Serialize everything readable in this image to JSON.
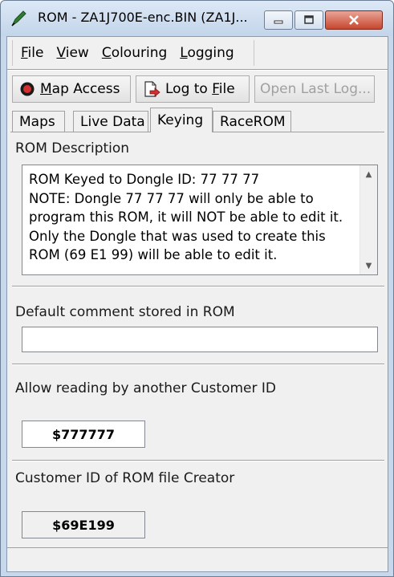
{
  "window": {
    "title": "ROM - ZA1J700E-enc.BIN (ZA1J...",
    "icons": {
      "app": "pen-icon",
      "minimize": "minimize-icon",
      "maximize": "maximize-icon",
      "close": "close-icon"
    }
  },
  "menu": {
    "file": "File",
    "view": "View",
    "colouring": "Colouring",
    "logging": "Logging"
  },
  "toolbar": {
    "map_access": "Map Access",
    "log_to_file": "Log to File",
    "open_last_log": "Open Last Log...",
    "icons": {
      "map_access": "record-icon",
      "log_to_file": "log-file-icon"
    }
  },
  "tabs": [
    "Maps",
    "Live Data",
    "Keying",
    "RaceROM"
  ],
  "active_tab": "Keying",
  "keying": {
    "rom_description_label": "ROM Description",
    "rom_description_value": "ROM Keyed to Dongle ID: 77 77 77\nNOTE: Dongle 77 77 77 will only be able to program this ROM, it will NOT be able to edit it.\nOnly the Dongle that was used to create this ROM (69 E1 99) will be able to edit it.",
    "default_comment_label": "Default comment stored in ROM",
    "default_comment_value": "",
    "allow_reading_label": "Allow reading by another Customer ID",
    "allow_reading_value": "$777777",
    "creator_label": "Customer ID of ROM file Creator",
    "creator_value": "$69E199"
  },
  "colors": {
    "title_bar": "#c8d8ec",
    "close_button": "#c7462e",
    "window_bg": "#f0f0f0"
  }
}
